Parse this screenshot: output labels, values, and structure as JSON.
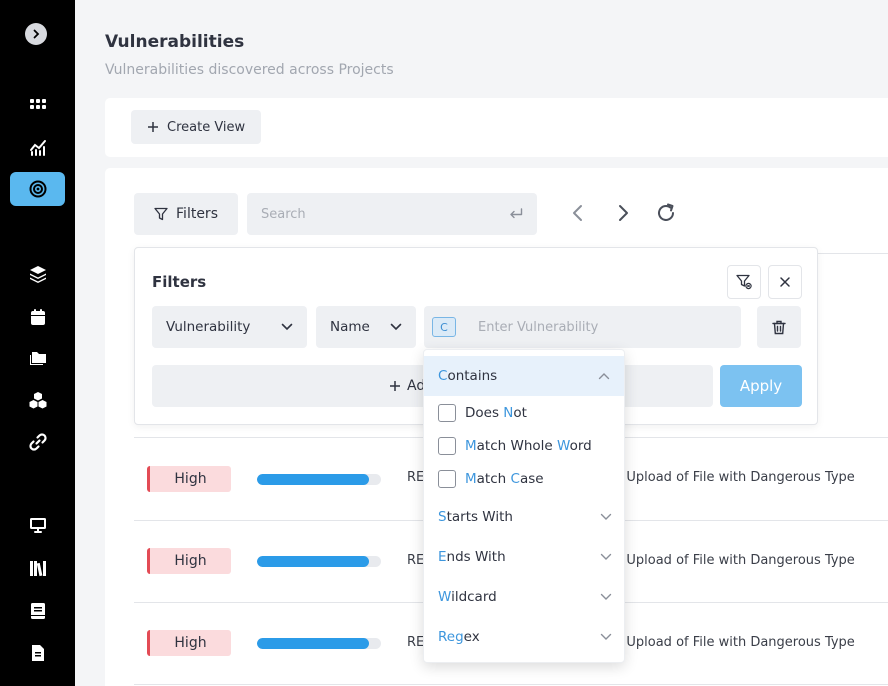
{
  "header": {
    "title": "Vulnerabilities",
    "subtitle": "Vulnerabilities discovered across Projects"
  },
  "toolbar": {
    "create_view_label": "Create View",
    "filters_label": "Filters",
    "search_placeholder": "Search"
  },
  "filter_panel": {
    "title": "Filters",
    "field_select": "Vulnerability",
    "attribute_select": "Name",
    "match_badge": "C",
    "value_placeholder": "Enter Vulnerability",
    "add_label": "Ad",
    "apply_label": "Apply"
  },
  "match_dropdown": {
    "selected": {
      "hl": "C",
      "rest": "ontains"
    },
    "checkbox_options": [
      [
        {
          "t": "Does ",
          "h": false
        },
        {
          "t": "N",
          "h": true
        },
        {
          "t": "ot",
          "h": false
        }
      ],
      [
        {
          "t": "M",
          "h": true
        },
        {
          "t": "atch Whole ",
          "h": false
        },
        {
          "t": "W",
          "h": true
        },
        {
          "t": "ord",
          "h": false
        }
      ],
      [
        {
          "t": "M",
          "h": true
        },
        {
          "t": "atch ",
          "h": false
        },
        {
          "t": "C",
          "h": true
        },
        {
          "t": "ase",
          "h": false
        }
      ]
    ],
    "options": [
      [
        {
          "t": "S",
          "h": true
        },
        {
          "t": "tarts With",
          "h": false
        }
      ],
      [
        {
          "t": "E",
          "h": true
        },
        {
          "t": "nds With",
          "h": false
        }
      ],
      [
        {
          "t": "W",
          "h": true
        },
        {
          "t": "ildcard",
          "h": false
        }
      ],
      [
        {
          "t": "Reg",
          "h": true
        },
        {
          "t": "ex",
          "h": false
        }
      ]
    ]
  },
  "table": {
    "rows": [
      {
        "severity": "High",
        "progress": 0.9,
        "project": "RE",
        "title": "ed Upload of File with Dangerous Type"
      },
      {
        "severity": "High",
        "progress": 0.9,
        "project": "RE",
        "title": "ed Upload of File with Dangerous Type"
      },
      {
        "severity": "High",
        "progress": 0.9,
        "project": "RE",
        "title": "ed Upload of File with Dangerous Type"
      }
    ]
  },
  "sidebar": {
    "items": [
      "grid-icon",
      "chart-icon",
      "target-icon",
      "layers-icon",
      "calendar-icon",
      "folders-icon",
      "cubes-icon",
      "link-icon",
      "monitor-icon",
      "library-icon",
      "book-icon",
      "document-icon"
    ],
    "active": "target-icon"
  },
  "colors": {
    "accent": "#5ab8ef",
    "apply": "#7cc2f1",
    "severity_high": "#e34b55",
    "bar": "#2b9be8"
  }
}
